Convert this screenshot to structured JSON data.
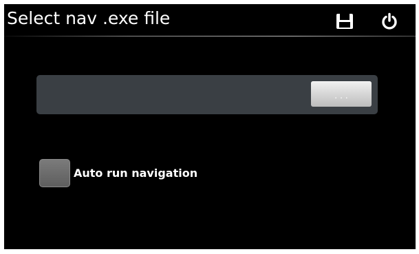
{
  "header": {
    "title": "Select nav .exe file",
    "save_icon": "floppy-disk-icon",
    "power_icon": "power-icon"
  },
  "path_panel": {
    "path_value": "",
    "path_placeholder": "",
    "browse_label": "..."
  },
  "options": {
    "auto_run_label": "Auto run navigation",
    "auto_run_checked": false
  },
  "colors": {
    "background": "#000000",
    "panel": "#3a3f44",
    "text": "#ffffff",
    "checkbox": "#6b6b6b"
  }
}
